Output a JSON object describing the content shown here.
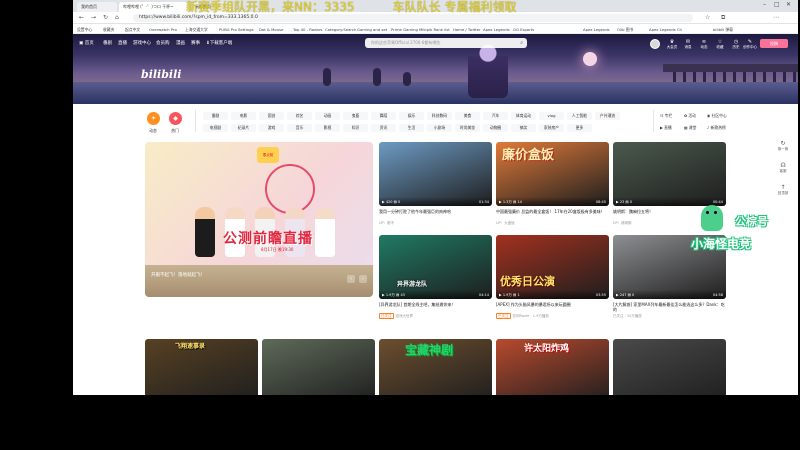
{
  "overlay": {
    "marquee": "新赛季组队开黑，来NN：3335",
    "marquee_tail": "车队队长 专属福利领取",
    "watermark_line1": "公棕号",
    "watermark_line2": "小海怪电竞"
  },
  "browser": {
    "tabs": [
      "我的首页",
      "哔哩哔哩 (゜-゜)つロ 干杯~",
      "新标签页"
    ],
    "url": "https://www.bilibili.com/?spm_id_from=333.1365.0.0",
    "bookmarks": [
      "设置中心",
      "收藏夹",
      "起点中文",
      "Overwatch Pro",
      "上海交通大学",
      "PUBG Pro Settings",
      "Dot & Mouse",
      "Top 40 - Radars",
      "Category:Search",
      "Gaming and set",
      "Prime Gaming",
      "Mikipik Rank list",
      "Home / Twitter",
      "Apex Legends",
      "GG Esports",
      "Apex Legends",
      "Olib 图书",
      "Apex Legends Ch",
      "bilibili 弹幕"
    ]
  },
  "topnav": {
    "items": [
      "首页",
      "番剧",
      "直播",
      "游戏中心",
      "会员购",
      "漫画",
      "赛事",
      "下载客户端"
    ],
    "search_placeholder": "你的这些苹果Official 2700-6都有哪些",
    "right": [
      "大会员",
      "消息",
      "动态",
      "收藏",
      "历史",
      "创作中心"
    ],
    "upload": "投稿"
  },
  "logo": "bilibili",
  "channels": {
    "dynamic": "动态",
    "hot": "热门",
    "row1": [
      "番剧",
      "电影",
      "国创",
      "综艺",
      "动画",
      "鬼畜",
      "舞蹈",
      "娱乐",
      "科技数码",
      "美食",
      "汽车",
      "体育运动",
      "vlog",
      "人工智能",
      "户外潮流"
    ],
    "row2": [
      "电视剧",
      "纪录片",
      "游戏",
      "音乐",
      "影视",
      "知识",
      "资讯",
      "生活",
      "小剧场",
      "时尚美妆",
      "动物圈",
      "搞笑",
      "家装房产",
      "更多"
    ],
    "right_row1": [
      "专栏",
      "活动",
      "社区中心"
    ],
    "right_row2": [
      "直播",
      "课堂",
      "新歌热榜"
    ]
  },
  "carousel": {
    "caption": "开服不起飞！落地就起飞！",
    "headline": "公测前瞻直播",
    "sub": "8月17日 晚19:30",
    "tag": "零点前",
    "dots": 9
  },
  "videos": [
    {
      "title": "我用一分钟打败了他今年最强巨的肉神哈",
      "up": "UP：都不",
      "views": "420",
      "danmaku": "0",
      "duration": "01:34",
      "thumb_text": "",
      "thumb_color": "#6d9bc4"
    },
    {
      "title": "中国最强廉价 总监的最全盒饭！ 17年在20盒饭极有多美味！",
      "up": "UP：大盘饭",
      "views": "1.3万",
      "danmaku": "14",
      "duration": "08:45",
      "thumb_text": "廉价盒饭",
      "thumb_color": "#e07a3a"
    },
    {
      "title": "姚明斯：魏麻拉五将！",
      "up": "UP：姚明斯",
      "views": "23",
      "danmaku": "0",
      "duration": "00:44",
      "thumb_text": "",
      "thumb_color": "#4b5a4d"
    },
    {
      "title": "[异界游龙队] 首期全线主吧，集结邀你来！",
      "up": "游戏大世界",
      "views": "1.9万",
      "danmaku": "43",
      "duration": "04:14",
      "thumb_text": "异界游龙队",
      "thumb_color": "#1f7a64",
      "tag": "已关注"
    },
    {
      "title": "[APEX] 作为头脑风暴的暴君所以来玩圆圈",
      "up": "凯利Razer · 1.9万播放",
      "views": "1.9万",
      "danmaku": "1",
      "duration": "03:55",
      "thumb_text": "优秀日公演",
      "thumb_color": "#a3311f",
      "tag": "已关注"
    },
    {
      "title": "[大片解惑] 家里MAX列车最新最佳怎么能选这么多？Dank：吃的",
      "up": "已关注 · 10万播放",
      "views": "247",
      "danmaku": "0",
      "duration": "04:58",
      "thumb_text": "",
      "thumb_color": "#8e8f92"
    },
    {
      "title": "",
      "up": "",
      "views": "",
      "danmaku": "",
      "duration": "",
      "thumb_text": "飞翔速事录",
      "thumb_color": "#574123"
    },
    {
      "title": "",
      "up": "",
      "views": "",
      "danmaku": "",
      "duration": "",
      "thumb_text": "",
      "thumb_color": "#5e6a59"
    },
    {
      "title": "",
      "up": "",
      "views": "",
      "danmaku": "",
      "duration": "",
      "thumb_text": "宝藏神剧",
      "thumb_color": "#6c4e2e"
    },
    {
      "title": "",
      "up": "",
      "views": "",
      "danmaku": "",
      "duration": "",
      "thumb_text": "许太阳炸鸡",
      "thumb_color": "#b84a2e"
    },
    {
      "title": "",
      "up": "",
      "views": "",
      "danmaku": "",
      "duration": "",
      "thumb_text": "",
      "thumb_color": "#4a4a4a"
    }
  ],
  "rail": [
    "换一换",
    "客服",
    "回顶部"
  ],
  "colors": {
    "brand_pink": "#fb7299",
    "brand_blue": "#00aeec",
    "hot_orange": "#ff6c00"
  }
}
